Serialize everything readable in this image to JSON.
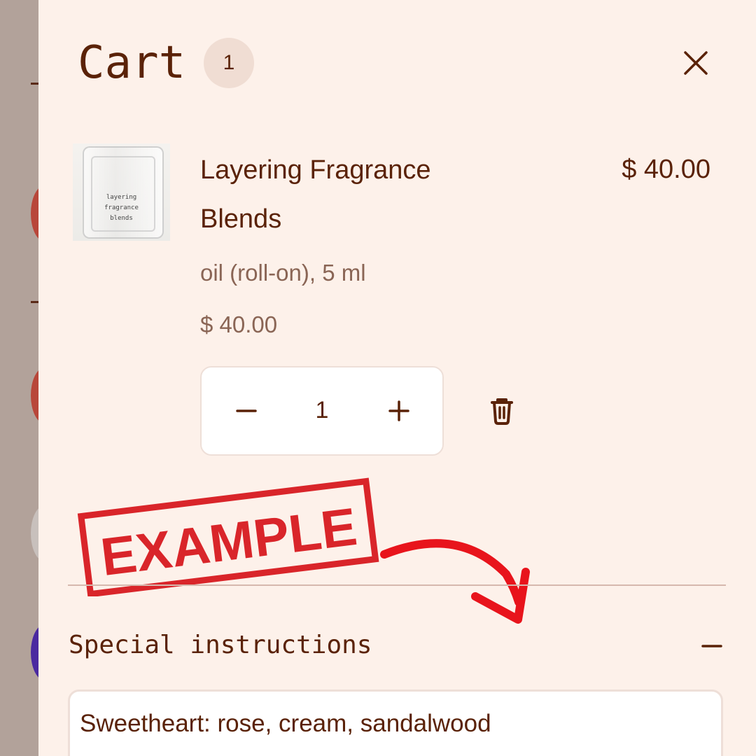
{
  "cart": {
    "title": "Cart",
    "count": "1",
    "close_icon": "close-icon"
  },
  "item": {
    "image_label_lines": [
      "layering",
      "fragrance",
      "blends"
    ],
    "name": "Layering Fragrance Blends",
    "price": "$ 40.00",
    "variant": "oil (roll-on), 5 ml",
    "unit_price": "$ 40.00",
    "quantity": "1",
    "icons": [
      "minus-icon",
      "plus-icon",
      "trash-icon"
    ]
  },
  "overlay": {
    "stamp_text": "EXAMPLE",
    "stamp_color": "#d9252a",
    "arrow_color": "#e8141c"
  },
  "special_instructions": {
    "label": "Special instructions",
    "toggle_icon": "minus-icon",
    "value": "Sweetheart: rose, cream, sandalwood"
  },
  "colors": {
    "drawer_bg": "#fdf1ea",
    "text": "#5a2208",
    "muted": "#8a6555",
    "backdrop": "#b2a29a"
  }
}
